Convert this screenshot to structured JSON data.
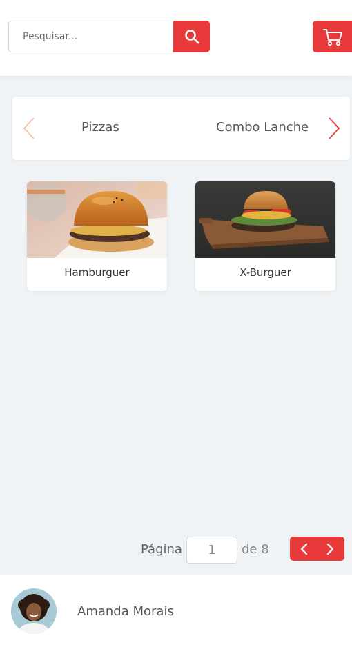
{
  "header": {
    "search": {
      "placeholder": "Pesquisar..."
    },
    "search_icon": "search-icon",
    "cart_icon": "cart-icon"
  },
  "categories": {
    "prev_icon": "chevron-left-icon",
    "next_icon": "chevron-right-icon",
    "items": [
      {
        "label": "Pizzas"
      },
      {
        "label": "Combo Lanche"
      }
    ]
  },
  "products": [
    {
      "name": "Hamburguer",
      "image": "burger-photo"
    },
    {
      "name": "X-Burguer",
      "image": "x-burger-photo"
    }
  ],
  "pagination": {
    "label": "Página",
    "current_page": "1",
    "total_label": "de 8",
    "prev_icon": "chevron-left-icon",
    "next_icon": "chevron-right-icon"
  },
  "user": {
    "name": "Amanda Morais",
    "avatar": "user-avatar-photo"
  },
  "colors": {
    "accent": "#e8393a",
    "background": "#f0f3f5",
    "surface": "#ffffff"
  }
}
